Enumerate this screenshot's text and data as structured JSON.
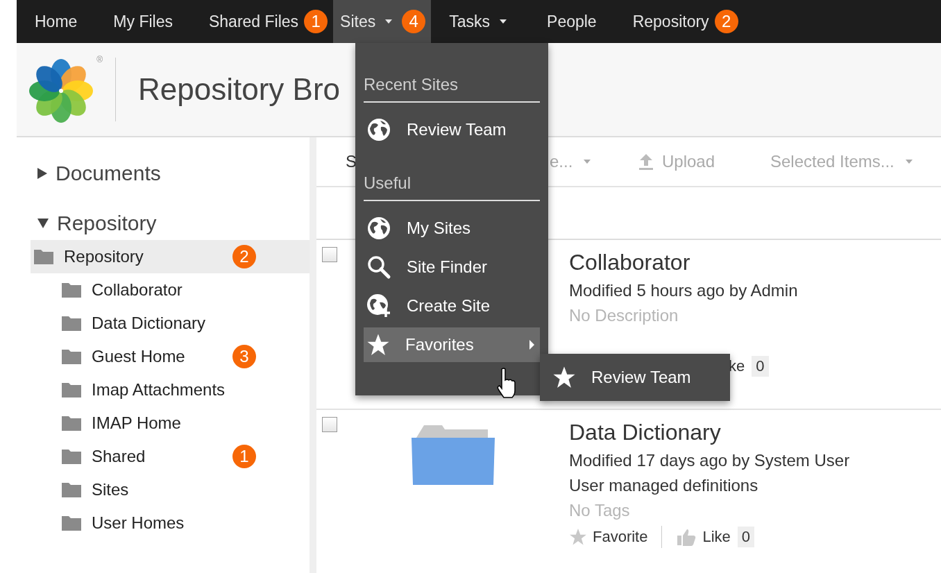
{
  "nav": [
    {
      "label": "Home",
      "selected": false,
      "caret": false
    },
    {
      "label": "My Files",
      "selected": false,
      "caret": false
    },
    {
      "label": "Shared Files",
      "selected": false,
      "caret": false,
      "badge": "1"
    },
    {
      "label": "Sites",
      "selected": true,
      "caret": true,
      "badge": "4"
    },
    {
      "label": "Tasks",
      "selected": false,
      "caret": true
    },
    {
      "label": "People",
      "selected": false,
      "caret": false
    },
    {
      "label": "Repository",
      "selected": false,
      "caret": false,
      "badge": "2"
    }
  ],
  "header": {
    "title": "Repository Bro",
    "registered_mark": "®"
  },
  "sidebar": {
    "sections": [
      {
        "label": "Documents",
        "expanded": false
      },
      {
        "label": "Repository",
        "expanded": true,
        "tree": [
          {
            "label": "Repository",
            "selected": true,
            "badge": "2",
            "children": [
              {
                "label": "Collaborator",
                "selected": false
              },
              {
                "label": "Data Dictionary",
                "selected": false
              },
              {
                "label": "Guest Home",
                "selected": false,
                "badge": "3"
              },
              {
                "label": "Imap Attachments",
                "selected": false
              },
              {
                "label": "IMAP Home",
                "selected": false
              },
              {
                "label": "Shared",
                "selected": false,
                "badge": "1"
              },
              {
                "label": "Sites",
                "selected": false
              },
              {
                "label": "User Homes",
                "selected": false
              }
            ]
          }
        ]
      }
    ]
  },
  "toolbar": [
    {
      "kind": "menu",
      "label": "S"
    },
    {
      "kind": "menu",
      "label": "e...",
      "caret": true
    },
    {
      "kind": "upload",
      "label": "Upload",
      "caret": false
    },
    {
      "kind": "menu",
      "label": "Selected Items...",
      "caret": true
    }
  ],
  "rows": [
    {
      "checked": false,
      "thumbnail": false,
      "title": "Collaborator",
      "modified": "Modified 5 hours ago by Admin",
      "description": "No Description",
      "description_empty": true,
      "like_label": "ke",
      "like_count": "0"
    },
    {
      "checked": false,
      "thumbnail": true,
      "title": "Data Dictionary",
      "modified": "Modified 17 days ago by System User",
      "description": "User managed definitions",
      "description_empty": false,
      "tags": "No Tags",
      "favorite": "Favorite",
      "like_label": "Like",
      "like_count": "0"
    }
  ],
  "sites_menu": {
    "groups": [
      {
        "heading": "Recent Sites",
        "items": [
          {
            "kind": "site",
            "label": "Review Team",
            "selected": false
          }
        ]
      },
      {
        "heading": "Useful",
        "items": [
          {
            "kind": "site",
            "label": "My Sites",
            "selected": false
          },
          {
            "kind": "finder",
            "label": "Site Finder",
            "selected": false
          },
          {
            "kind": "create",
            "label": "Create Site",
            "selected": false
          },
          {
            "kind": "favorites",
            "label": "Favorites",
            "selected": true
          }
        ]
      }
    ],
    "submenu": [
      {
        "label": "Review Team"
      }
    ]
  }
}
